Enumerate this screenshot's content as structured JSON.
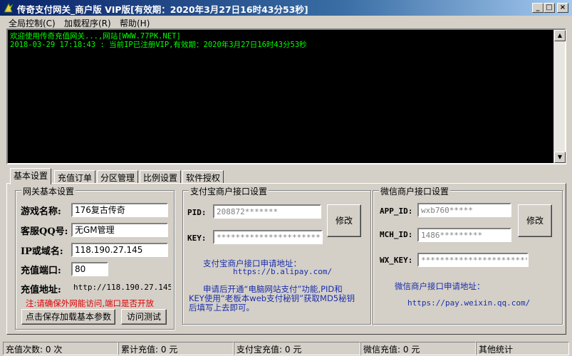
{
  "window": {
    "title": "传奇支付网关_商户版 VIP版[有效期：2020年3月27日16时43分53秒]",
    "controls": {
      "minimize": "_",
      "maximize": "□",
      "close": "×"
    }
  },
  "menu": [
    "全局控制(C)",
    "加载程序(R)",
    "帮助(H)"
  ],
  "log": [
    "欢迎使用传奇充值网关...,网站[WWW.77PK.NET]",
    "2018-03-29 17:18:43 : 当前IP已注册VIP,有效期：2020年3月27日16时43分53秒"
  ],
  "tabs": [
    "基本设置",
    "充值订单",
    "分区管理",
    "比例设置",
    "软件授权"
  ],
  "gateway": {
    "title": "网关基本设置",
    "game_name_label": "游戏名称:",
    "game_name": "176复古传奇",
    "qq_label": "客服QQ号:",
    "qq": "无GM管理",
    "ip_label": "IP或域名:",
    "ip": "118.190.27.145",
    "port_label": "充值端口:",
    "port": "80",
    "addr_label": "充值地址:",
    "addr": "http://118.190.27.145",
    "note": "注:请确保外网能访问,端口是否开放",
    "save_button": "点击保存加载基本参数",
    "test_button": "访问测试"
  },
  "alipay": {
    "title": "支付宝商户接口设置",
    "pid_label": "PID:",
    "pid": "208872*******",
    "key_label": "KEY:",
    "key": "************************",
    "modify_button": "修改",
    "apply_label": "支付宝商户接口申请地址：",
    "apply_url": "https://b.alipay.com/",
    "note1": "申请后开通“电脑网站支付”功能,PID和",
    "note2": "KEY使用“老板本web支付秘钥”获取MD5秘钥",
    "note3": "后填写上去即可。"
  },
  "wechat": {
    "title": "微信商户接口设置",
    "appid_label": "APP_ID:",
    "appid": "wxb760*****",
    "mchid_label": "MCH_ID:",
    "mchid": "1486*********",
    "wxkey_label": "WX_KEY:",
    "wxkey": "**************************",
    "modify_button": "修改",
    "apply_label": "微信商户接口申请地址：",
    "apply_url": "https://pay.weixin.qq.com/"
  },
  "status": [
    {
      "label": "充值次数:",
      "value": "0 次"
    },
    {
      "label": "累计充值:",
      "value": "0 元"
    },
    {
      "label": "支付宝充值:",
      "value": "0 元"
    },
    {
      "label": "微信充值:",
      "value": "0 元"
    },
    {
      "label": "其他统计",
      "value": ""
    }
  ]
}
